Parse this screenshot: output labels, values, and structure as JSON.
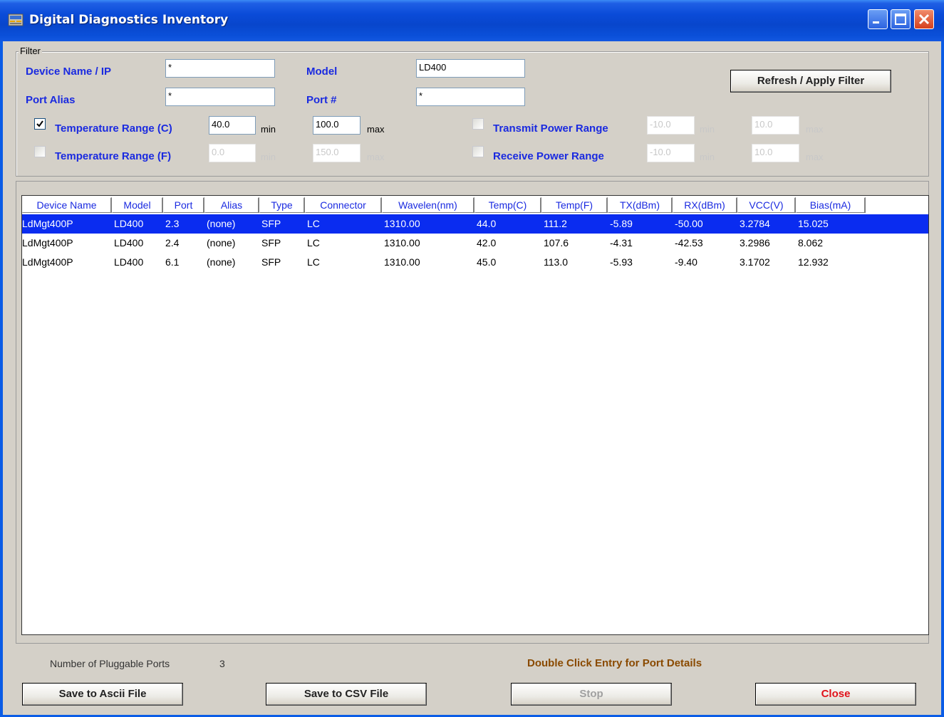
{
  "window": {
    "title": "Digital Diagnostics Inventory"
  },
  "filter": {
    "legend": "Filter",
    "device_label": "Device Name / IP",
    "device_value": "*",
    "model_label": "Model",
    "model_value": "LD400",
    "alias_label": "Port Alias",
    "alias_value": "*",
    "port_label": "Port #",
    "port_value": "*",
    "refresh_button": "Refresh  / Apply Filter",
    "temp_c": {
      "label": "Temperature Range (C)",
      "checked": true,
      "min": "40.0",
      "max": "100.0",
      "min_label": "min",
      "max_label": "max"
    },
    "temp_f": {
      "label": "Temperature Range (F)",
      "checked": false,
      "min": "0.0",
      "max": "150.0",
      "min_label": "min",
      "max_label": "max"
    },
    "tx": {
      "label": "Transmit Power Range",
      "checked": false,
      "min": "-10.0",
      "max": "10.0",
      "min_label": "min",
      "max_label": "max"
    },
    "rx": {
      "label": "Receive Power Range",
      "checked": false,
      "min": "-10.0",
      "max": "10.0",
      "min_label": "min",
      "max_label": "max"
    }
  },
  "table": {
    "columns": [
      "Device Name",
      "Model",
      "Port",
      "Alias",
      "Type",
      "Connector",
      "Wavelen(nm)",
      "Temp(C)",
      "Temp(F)",
      "TX(dBm)",
      "RX(dBm)",
      "VCC(V)",
      "Bias(mA)"
    ],
    "rows": [
      [
        "LdMgt400P",
        "LD400",
        "2.3",
        "(none)",
        "SFP",
        "LC",
        "1310.00",
        "44.0",
        "111.2",
        "-5.89",
        "-50.00",
        "3.2784",
        "15.025"
      ],
      [
        "LdMgt400P",
        "LD400",
        "2.4",
        "(none)",
        "SFP",
        "LC",
        "1310.00",
        "42.0",
        "107.6",
        "-4.31",
        "-42.53",
        "3.2986",
        "8.062"
      ],
      [
        "LdMgt400P",
        "LD400",
        "6.1",
        "(none)",
        "SFP",
        "LC",
        "1310.00",
        "45.0",
        "113.0",
        "-5.93",
        "-9.40",
        "3.1702",
        "12.932"
      ]
    ],
    "selected_row": 0
  },
  "status": {
    "count_label": "Number of Pluggable Ports",
    "count_value": "3",
    "hint": "Double Click Entry for Port Details"
  },
  "buttons": {
    "save_ascii": "Save to Ascii File",
    "save_csv": "Save to CSV File",
    "stop": "Stop",
    "close": "Close"
  },
  "colors": {
    "label_blue": "#1A2AE0",
    "selection": "#0A2CF0",
    "hint": "#8A4A00",
    "close_red": "#E0121A"
  }
}
